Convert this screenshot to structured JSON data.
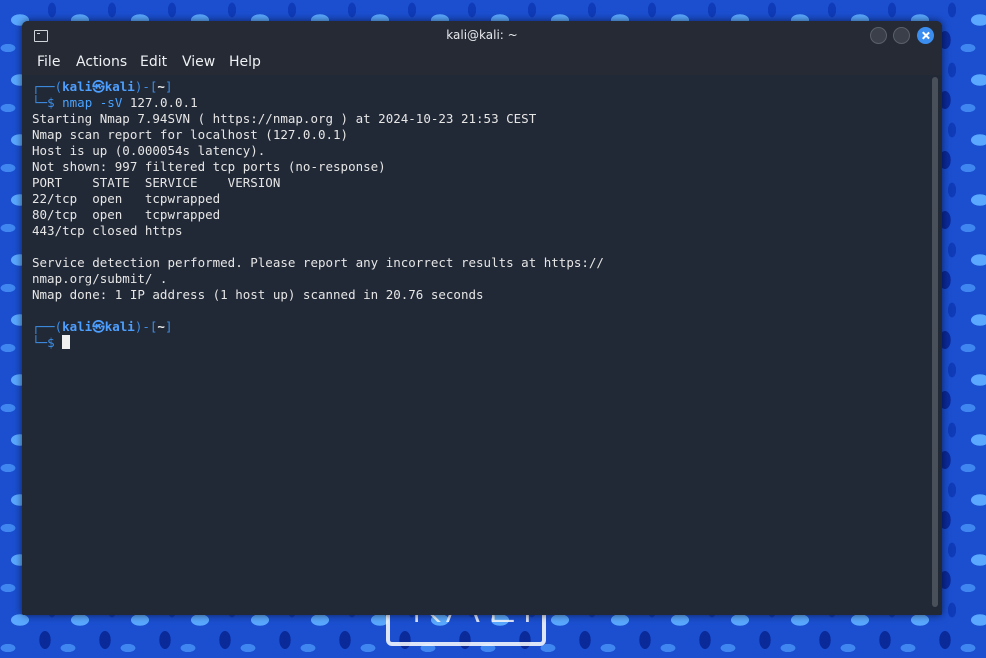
{
  "window": {
    "title": "kali@kali: ~"
  },
  "menu": {
    "items": [
      "File",
      "Actions",
      "Edit",
      "View",
      "Help"
    ]
  },
  "prompt": {
    "top_left": "┌──(",
    "user": "kali㉿kali",
    "middle": ")-[",
    "dir": "~",
    "close": "]",
    "bottom_left": "└─",
    "dollar": "$"
  },
  "command": {
    "name": "nmap",
    "args": "-sV",
    "target": "127.0.0.1"
  },
  "output": [
    "Starting Nmap 7.94SVN ( https://nmap.org ) at 2024-10-23 21:53 CEST",
    "Nmap scan report for localhost (127.0.0.1)",
    "Host is up (0.000054s latency).",
    "Not shown: 997 filtered tcp ports (no-response)",
    "PORT    STATE  SERVICE    VERSION",
    "22/tcp  open   tcpwrapped",
    "80/tcp  open   tcpwrapped",
    "443/tcp closed https",
    "",
    "Service detection performed. Please report any incorrect results at https://",
    "nmap.org/submit/ .",
    "Nmap done: 1 IP address (1 host up) scanned in 20.76 seconds"
  ],
  "wallpaper": {
    "logo_text": "KALI"
  },
  "colors": {
    "terminal_bg": "#212836",
    "accent": "#3d8ee6",
    "close_button": "#3b8ef0"
  }
}
